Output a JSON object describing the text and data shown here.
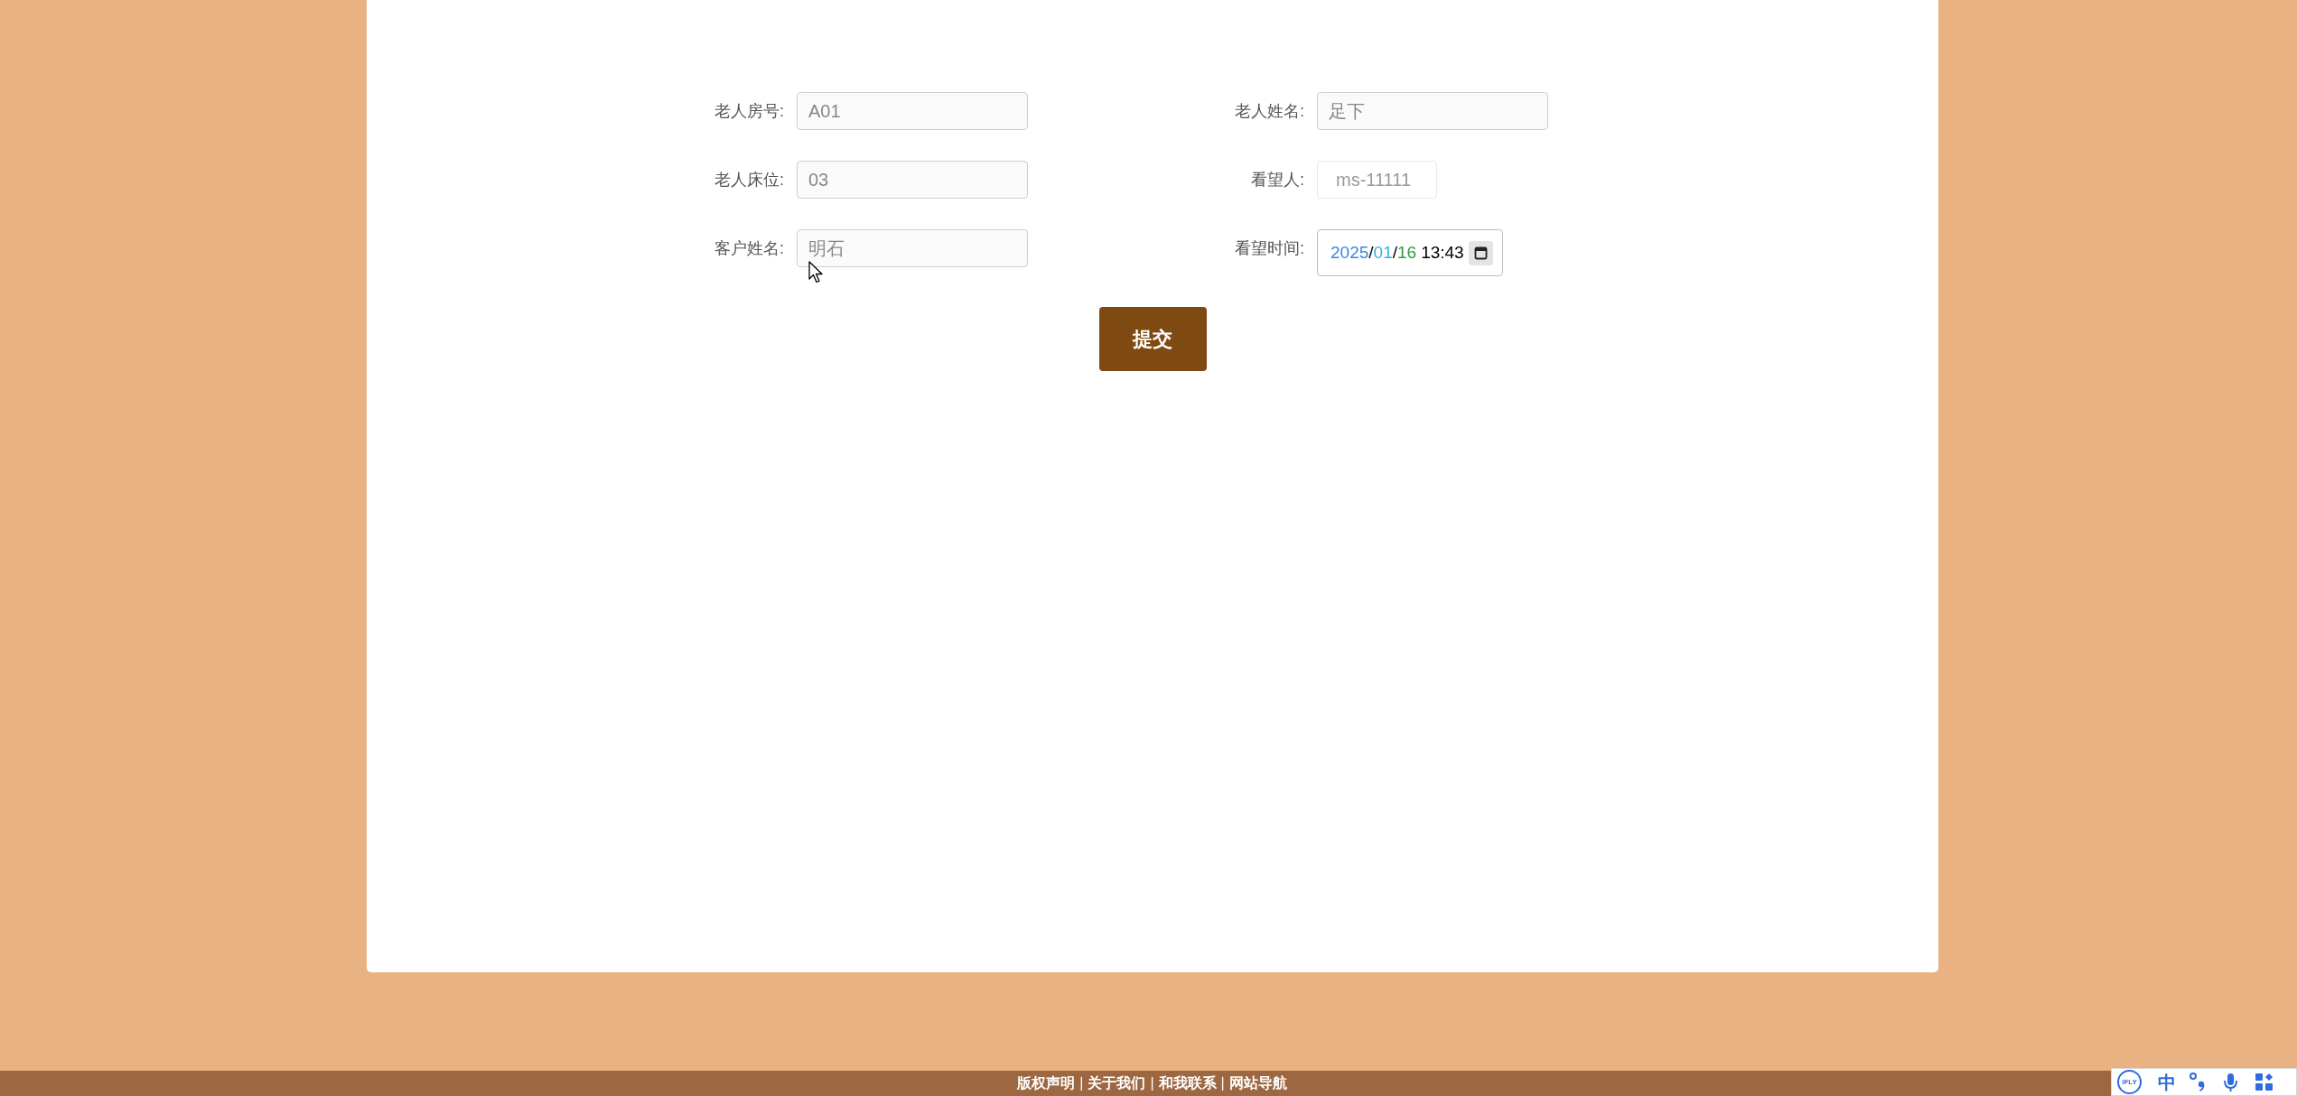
{
  "form": {
    "fields": [
      {
        "kind": "readonly",
        "label": "老人房号:",
        "value": "A01"
      },
      {
        "kind": "readonly",
        "label": "老人姓名:",
        "value": "足下"
      },
      {
        "kind": "readonly",
        "label": "老人床位:",
        "value": "03"
      },
      {
        "kind": "plain",
        "label": "看望人:",
        "value": "ms-11111"
      },
      {
        "kind": "readonly",
        "label": "客户姓名:",
        "value": "明石"
      },
      {
        "kind": "datetime",
        "label": "看望时间:",
        "segments": [
          {
            "text": "2025",
            "color": "#3a86e0"
          },
          {
            "text": "/",
            "color": "#000000"
          },
          {
            "text": "01",
            "color": "#35b3e8"
          },
          {
            "text": "/",
            "color": "#000000"
          },
          {
            "text": "16",
            "color": "#2a9d3f"
          },
          {
            "text": "13:43",
            "color": "#000000"
          }
        ]
      }
    ],
    "submit": "提交"
  },
  "footer": {
    "items": [
      {
        "kind": "link",
        "text": "版权声明"
      },
      {
        "kind": "separator",
        "text": "|"
      },
      {
        "kind": "link",
        "text": "关于我们"
      },
      {
        "kind": "separator",
        "text": "|"
      },
      {
        "kind": "link",
        "text": "和我联系"
      },
      {
        "kind": "separator",
        "text": "|"
      },
      {
        "kind": "link",
        "text": "网站导航"
      }
    ]
  },
  "ime_toolbar": {
    "logo": "iFLY",
    "mode": "中"
  }
}
